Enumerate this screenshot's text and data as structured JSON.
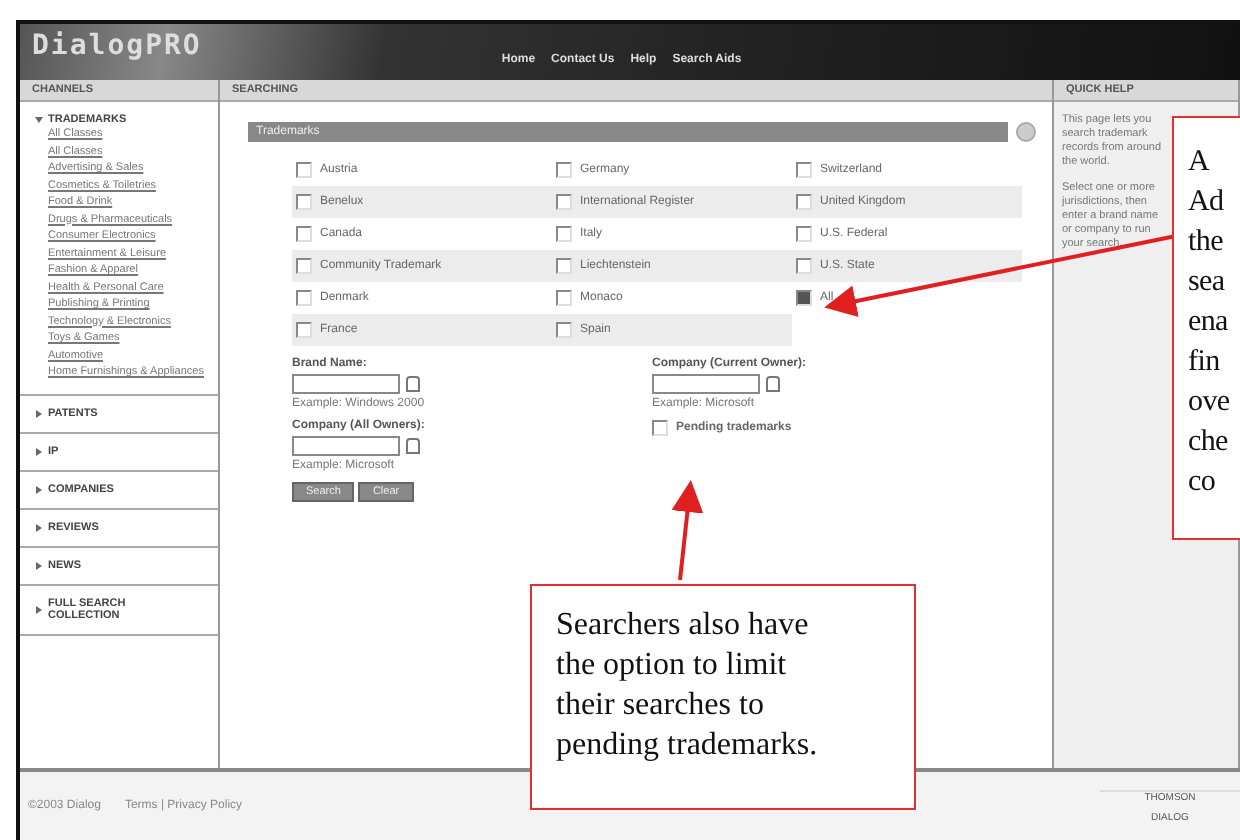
{
  "header": {
    "logo": "DialogPRO",
    "nav": [
      "Home",
      "Contact Us",
      "Help",
      "Search Aids"
    ]
  },
  "column_headers": {
    "left": "CHANNELS",
    "main": "SEARCHING",
    "right": "QUICK HELP"
  },
  "sidebar": [
    {
      "label": "TRADEMARKS",
      "expanded": true,
      "children": [
        "All Classes",
        "All Classes",
        "Advertising & Sales",
        "Cosmetics & Toiletries",
        "Food & Drink",
        "Drugs & Pharmaceuticals",
        "Consumer Electronics",
        "Entertainment & Leisure",
        "Fashion & Apparel",
        "Health & Personal Care",
        "Publishing & Printing",
        "Technology & Electronics",
        "Toys & Games",
        "Automotive",
        "Home Furnishings & Appliances"
      ]
    },
    {
      "label": "PATENTS",
      "expanded": false
    },
    {
      "label": "IP",
      "expanded": false
    },
    {
      "label": "COMPANIES",
      "expanded": false
    },
    {
      "label": "REVIEWS",
      "expanded": false
    },
    {
      "label": "NEWS",
      "expanded": false
    },
    {
      "label": "FULL SEARCH COLLECTION",
      "expanded": false
    }
  ],
  "section_title": "Trademarks",
  "jurisdictions": [
    {
      "label": "Austria",
      "checked": false
    },
    {
      "label": "Germany",
      "checked": false
    },
    {
      "label": "Switzerland",
      "checked": false
    },
    {
      "label": "Benelux",
      "checked": false
    },
    {
      "label": "International Register",
      "checked": false
    },
    {
      "label": "United Kingdom",
      "checked": false
    },
    {
      "label": "Canada",
      "checked": false
    },
    {
      "label": "Italy",
      "checked": false
    },
    {
      "label": "U.S. Federal",
      "checked": false
    },
    {
      "label": "Community Trademark",
      "checked": false
    },
    {
      "label": "Liechtenstein",
      "checked": false
    },
    {
      "label": "U.S. State",
      "checked": false
    },
    {
      "label": "Denmark",
      "checked": false
    },
    {
      "label": "Monaco",
      "checked": false
    },
    {
      "label": "All",
      "checked": true
    },
    {
      "label": "France",
      "checked": false
    },
    {
      "label": "Spain",
      "checked": false
    }
  ],
  "fields_left": [
    {
      "label": "Brand Name:",
      "example": "Example: Windows 2000"
    },
    {
      "label": "Company (All Owners):",
      "example": "Example: Microsoft"
    }
  ],
  "fields_right": [
    {
      "label": "Company (Current Owner):",
      "example": "Example: Microsoft"
    }
  ],
  "pending": {
    "label": "Pending trademarks",
    "checked": false
  },
  "buttons": [
    "Search",
    "Clear"
  ],
  "help_text": [
    "This page lets you search trademark records from around the world.",
    "Select one or more jurisdictions, then enter a brand name or company to run your search."
  ],
  "footer": {
    "text": "©2003 Dialog",
    "links": "Terms | Privacy Policy",
    "logo_top": "THOMSON",
    "logo_bottom": "DIALOG"
  },
  "callouts": [
    {
      "lines": [
        "A",
        "Ad",
        "the",
        "sea",
        "ena",
        "fin",
        "ove",
        "che",
        "co"
      ]
    },
    {
      "lines": [
        "Searchers also have",
        "the option to limit",
        "their searches to",
        "pending trademarks."
      ]
    }
  ]
}
